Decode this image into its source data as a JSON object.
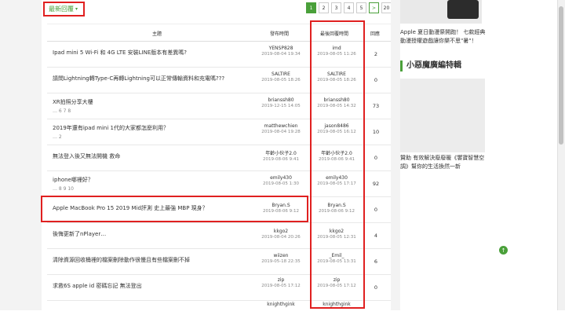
{
  "sort": {
    "label": "最新回覆",
    "caret": "▾"
  },
  "pagination": {
    "pages": [
      "1",
      "2",
      "3",
      "4",
      "5"
    ],
    "next": ">",
    "last": "20"
  },
  "table": {
    "headers": {
      "title": "主題",
      "poster": "發布時間",
      "last": "最後回覆時間",
      "replies": "回應"
    },
    "rows": [
      {
        "title": "Ipad mini 5 Wi-Fi 和 4G LTE 安裝LINE版本有差異嗎?",
        "pages": "",
        "poster": "YENSP828",
        "post_date": "2019-08-04 19:34",
        "last_user": "imd",
        "last_date": "2019-08-05 11:26",
        "replies": "2"
      },
      {
        "title": "請問Lightning轉Type-C再轉Lightning可以正常傳輸資料和充電嗎???",
        "pages": "",
        "poster": "SALTIRE",
        "post_date": "2019-08-05 18:26",
        "last_user": "SALTIRE",
        "last_date": "2019-08-05 18:26",
        "replies": "0"
      },
      {
        "title": "XR拍照分享大樓",
        "pages": "… 6 7 8",
        "poster": "brianssh80",
        "post_date": "2019-12-15 14:05",
        "last_user": "brianssh80",
        "last_date": "2019-08-05 14:32",
        "replies": "73"
      },
      {
        "title": "2019年還有ipad mini 1代的大家都怎麼利用？",
        "pages": "… 2",
        "poster": "matthewchien",
        "post_date": "2019-08-04 19:28",
        "last_user": "jason8486",
        "last_date": "2019-08-05 16:12",
        "replies": "10"
      },
      {
        "title": "無法登入後又無法開機 救命",
        "pages": "",
        "poster": "年齡小伙子2.0",
        "post_date": "2019-08-06 9:41",
        "last_user": "年齡小伙子2.0",
        "last_date": "2019-08-06 9:41",
        "replies": "0"
      },
      {
        "title": "iphone哪裡好？",
        "pages": "… 8 9 10",
        "poster": "emily430",
        "post_date": "2019-08-05 1:30",
        "last_user": "emily430",
        "last_date": "2019-08-05 17:17",
        "replies": "92"
      },
      {
        "title": "Apple MacBook Pro 15 2019 Mid評測 史上最強 MBP 現身？",
        "pages": "",
        "poster": "Bryan.S",
        "post_date": "2019-08-06 9:12",
        "last_user": "Bryan.S",
        "last_date": "2019-08-06 9:12",
        "replies": "0"
      },
      {
        "title": "後悔更新了nPlayer…",
        "pages": "",
        "poster": "kkgo2",
        "post_date": "2019-08-04 20:26",
        "last_user": "kkgo2",
        "last_date": "2019-08-05 12:31",
        "replies": "4"
      },
      {
        "title": "清除資源回收桶裡的檔案刪除動作很慢且有些檔案刪不掉",
        "pages": "",
        "poster": "wiizen",
        "post_date": "2019-05-18 22:35",
        "last_user": "_Emil_",
        "last_date": "2019-08-05 13:31",
        "replies": "6"
      },
      {
        "title": "求救6S apple id 密碼忘記 無法登出",
        "pages": "",
        "poster": "zip",
        "post_date": "2019-08-05 17:12",
        "last_user": "zip",
        "last_date": "2019-08-05 17:12",
        "replies": "0"
      },
      {
        "title": "",
        "pages": "",
        "poster": "knighthgink",
        "post_date": "",
        "last_user": "knighthgink",
        "last_date": "",
        "replies": ""
      }
    ]
  },
  "sidebar": {
    "promo_text": "Apple 夏日動漫祭開跑！ 七款經典動漫授權遊戲讓你樂不思\"暑\"！",
    "section_title": "小惡魔廣編特輯",
    "article_text": "贊助 有效解決廢廢暖《饗寶智慧空調》幫你的生活換然一新"
  },
  "colors": {
    "accent": "#4aa03a",
    "highlight": "#e02020"
  }
}
